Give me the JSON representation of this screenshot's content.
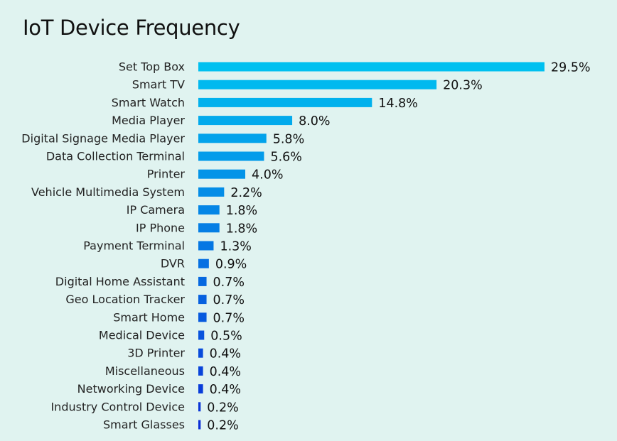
{
  "chart_data": {
    "type": "bar",
    "orientation": "horizontal",
    "title": "IoT Device Frequency",
    "xlabel": "",
    "ylabel": "",
    "value_suffix": "%",
    "grid": false,
    "legend": "none",
    "categories": [
      "Set Top Box",
      "Smart TV",
      "Smart Watch",
      "Media Player",
      "Digital Signage Media Player",
      "Data Collection Terminal",
      "Printer",
      "Vehicle Multimedia System",
      "IP Camera",
      "IP Phone",
      "Payment Terminal",
      "DVR",
      "Digital Home Assistant",
      "Geo Location Tracker",
      "Smart Home",
      "Medical Device",
      "3D Printer",
      "Miscellaneous",
      "Networking Device",
      "Industry Control Device",
      "Smart Glasses"
    ],
    "values": [
      29.5,
      20.3,
      14.8,
      8.0,
      5.8,
      5.6,
      4.0,
      2.2,
      1.8,
      1.8,
      1.3,
      0.9,
      0.7,
      0.7,
      0.7,
      0.5,
      0.4,
      0.4,
      0.4,
      0.2,
      0.2
    ],
    "labels": [
      "29.5%",
      "20.3%",
      "14.8%",
      "8.0%",
      "5.8%",
      "5.6%",
      "4.0%",
      "2.2%",
      "1.8%",
      "1.8%",
      "1.3%",
      "0.9%",
      "0.7%",
      "0.7%",
      "0.7%",
      "0.5%",
      "0.4%",
      "0.4%",
      "0.4%",
      "0.2%",
      "0.2%"
    ],
    "color_start": "#00c0f0",
    "color_end": "#0a2ed6"
  }
}
